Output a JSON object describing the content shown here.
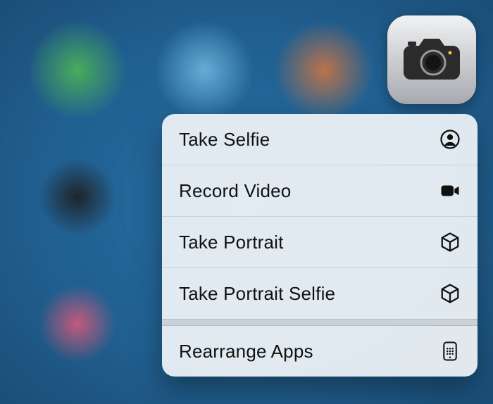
{
  "app_icon": {
    "name": "Camera"
  },
  "quick_actions": [
    {
      "label": "Take Selfie",
      "icon": "selfie-icon"
    },
    {
      "label": "Record Video",
      "icon": "video-icon"
    },
    {
      "label": "Take Portrait",
      "icon": "cube-icon"
    },
    {
      "label": "Take Portrait Selfie",
      "icon": "cube-icon"
    }
  ],
  "system_actions": [
    {
      "label": "Rearrange Apps",
      "icon": "homescreen-icon"
    }
  ]
}
